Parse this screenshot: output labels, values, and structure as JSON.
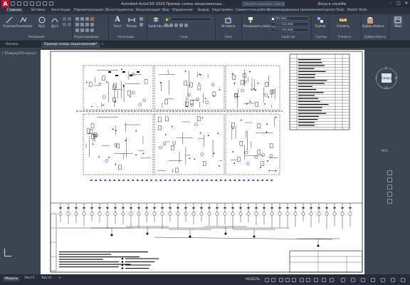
{
  "window": {
    "title": "Autodesk AutoCAD 2020   Пример схемы лицензионных...",
    "search_placeholder": "Введите ключевое слово/фразу",
    "signin": "Вход в службы"
  },
  "menu_tabs": [
    {
      "label": "Главная",
      "active": true
    },
    {
      "label": "Вставка"
    },
    {
      "label": "Аннотации"
    },
    {
      "label": "Параметризация"
    },
    {
      "label": "3D-инструменты"
    },
    {
      "label": "Визуализация"
    },
    {
      "label": "Вид"
    },
    {
      "label": "Управление"
    },
    {
      "label": "Вывод"
    },
    {
      "label": "Надстройки"
    },
    {
      "label": "Совместная работа"
    },
    {
      "label": "Рекомендованные приложения"
    },
    {
      "label": "Express Tools"
    },
    {
      "label": "Raster Tools"
    }
  ],
  "ribbon": {
    "buttons": {
      "line": "Отрезок",
      "polyline": "Полилиния",
      "circle": "Круг",
      "arc": "Дуга",
      "text": "Текст",
      "dimension": "Размер",
      "layer_props": "Свойства слоя",
      "insert": "Вставить",
      "match_props": "Копировать свойства",
      "groups": "Группа",
      "utilities": "Утилиты",
      "clipboard": "Буфер обмена",
      "view": "Вид"
    },
    "panels": [
      "Рисование",
      "Редактирование",
      "Аннотации",
      "Слои",
      "Блок",
      "Свойства",
      "Группы",
      "Утилиты",
      "Буфер обмена"
    ],
    "properties": {
      "color": "ПоСлою",
      "linetype": "—— ПоСлою",
      "lineweight": "—— ПоСлою"
    }
  },
  "doc_tabs": [
    {
      "label": "Начало"
    },
    {
      "label": "Пример схемы лицензионных*",
      "active": true
    }
  ],
  "viewport": {
    "label": "[–][Сверху][2D-каркас]",
    "viewcube_face": "Сверху",
    "viewcube_dirs": {
      "n": "С",
      "s": "Ю",
      "w": "З",
      "e": "В"
    },
    "wcs": "МСК"
  },
  "status_tabs": [
    {
      "label": "Модель",
      "active": true
    },
    {
      "label": "Лист1"
    },
    {
      "label": "Лист2"
    }
  ],
  "status": {
    "mode": "МОДЕЛЬ"
  },
  "colors": {
    "accent": "#c8102e",
    "ribbon_bg": "#3b4453",
    "canvas_bg": "#3c4350",
    "sheet": "#ffffff"
  }
}
